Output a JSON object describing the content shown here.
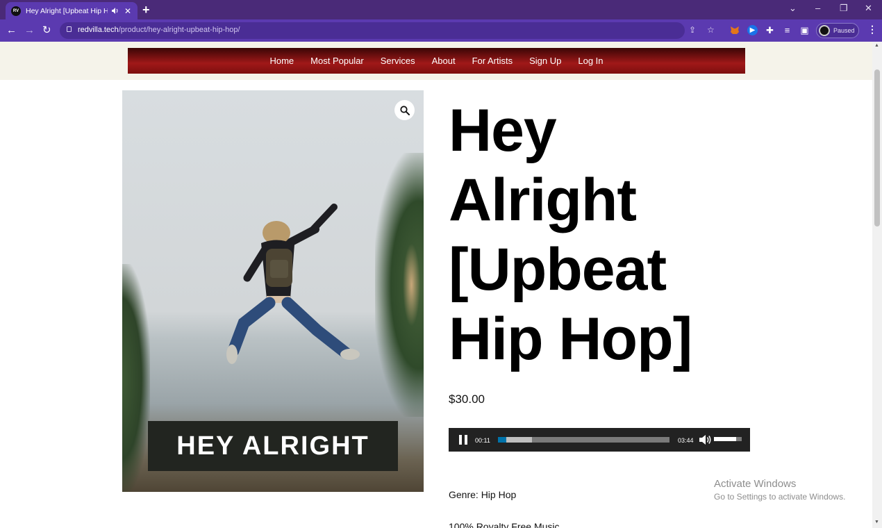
{
  "browser": {
    "tab": {
      "favicon_text": "RV",
      "title": "Hey Alright [Upbeat Hip Hop",
      "audio_icon": "speaker-icon",
      "close_icon": "close-icon"
    },
    "new_tab_icon": "plus-icon",
    "window_controls": {
      "tab_search": "⌄",
      "minimize": "–",
      "restore": "❐",
      "close": "✕"
    },
    "nav": {
      "back": "←",
      "forward": "→",
      "reload": "↻"
    },
    "url": {
      "domain": "redvilla.tech",
      "path": "/product/hey-alright-upbeat-hip-hop/"
    },
    "omnibox_icons": {
      "share": "⇪",
      "bookmark": "☆"
    },
    "extensions": [
      {
        "name": "metamask-icon",
        "color": "#e2761b",
        "glyph": "🦊"
      },
      {
        "name": "media-extension-icon",
        "color": "#1a73e8",
        "glyph": "▶"
      },
      {
        "name": "puzzle-icon",
        "color": "transparent",
        "glyph": "✚"
      },
      {
        "name": "reading-list-icon",
        "color": "transparent",
        "glyph": "≡"
      },
      {
        "name": "side-panel-icon",
        "color": "transparent",
        "glyph": "▣"
      }
    ],
    "profile_label": "Paused",
    "menu": "⋮"
  },
  "site_nav": [
    "Home",
    "Most Popular",
    "Services",
    "About",
    "For Artists",
    "Sign Up",
    "Log In"
  ],
  "product": {
    "image_caption": "HEY ALRIGHT",
    "zoom_icon": "magnifier-icon",
    "title_lines": [
      "Hey",
      "Alright",
      "[Upbeat",
      "Hip Hop]"
    ],
    "price": "$30.00",
    "genre": "Genre: Hip Hop",
    "next_line": "100% Royalty Free Music"
  },
  "audio_player": {
    "state": "playing",
    "current_time": "00:11",
    "duration": "03:44",
    "progress_fraction": 0.05,
    "buffered_fraction": 0.2,
    "volume_fraction": 0.8,
    "accent": "#0073aa"
  },
  "watermark": {
    "title": "Activate Windows",
    "subtitle": "Go to Settings to activate Windows."
  }
}
